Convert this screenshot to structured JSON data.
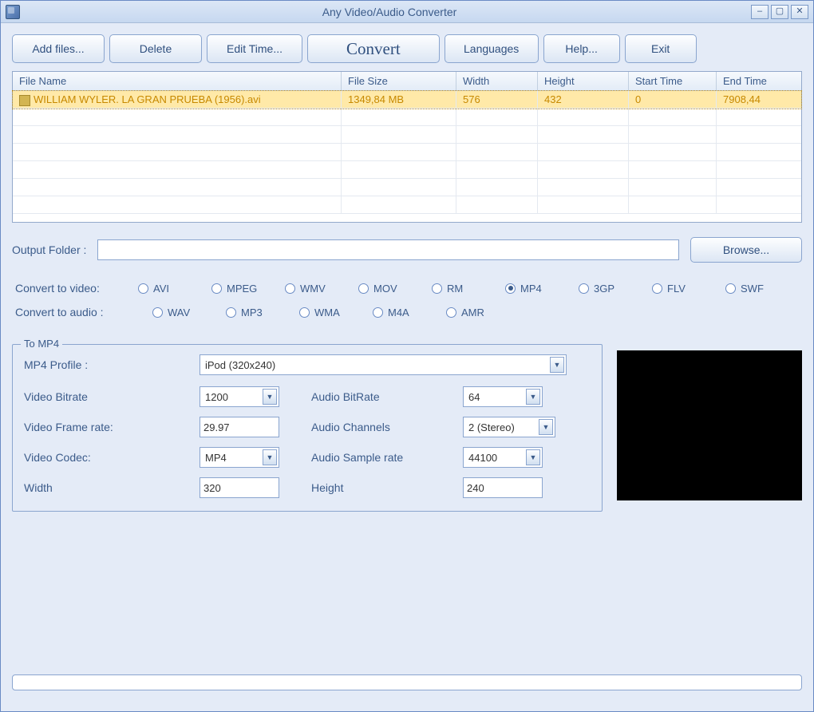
{
  "window": {
    "title": "Any Video/Audio Converter"
  },
  "toolbar": {
    "add_files": "Add files...",
    "delete": "Delete",
    "edit_time": "Edit Time...",
    "convert": "Convert",
    "languages": "Languages",
    "help": "Help...",
    "exit": "Exit"
  },
  "table": {
    "headers": {
      "file_name": "File Name",
      "file_size": "File Size",
      "width": "Width",
      "height": "Height",
      "start_time": "Start Time",
      "end_time": "End Time"
    },
    "rows": [
      {
        "file_name": "WILLIAM WYLER. LA GRAN PRUEBA (1956).avi",
        "file_size": "1349,84 MB",
        "width": "576",
        "height": "432",
        "start_time": "0",
        "end_time": "7908,44"
      }
    ]
  },
  "output": {
    "label": "Output Folder :",
    "value": "",
    "browse": "Browse..."
  },
  "video_formats": {
    "label": "Convert to video:",
    "options": [
      "AVI",
      "MPEG",
      "WMV",
      "MOV",
      "RM",
      "MP4",
      "3GP",
      "FLV",
      "SWF"
    ],
    "selected": "MP4"
  },
  "audio_formats": {
    "label": "Convert to audio :",
    "options": [
      "WAV",
      "MP3",
      "WMA",
      "M4A",
      "AMR"
    ],
    "selected": ""
  },
  "encoding": {
    "title": "To MP4",
    "profile_label": "MP4 Profile :",
    "profile_value": "iPod (320x240)",
    "video_bitrate_label": "Video Bitrate",
    "video_bitrate": "1200",
    "video_frame_rate_label": "Video Frame rate:",
    "video_frame_rate": "29.97",
    "video_codec_label": "Video Codec:",
    "video_codec": "MP4",
    "width_label": "Width",
    "width": "320",
    "audio_bitrate_label": "Audio BitRate",
    "audio_bitrate": "64",
    "audio_channels_label": "Audio Channels",
    "audio_channels": "2 (Stereo)",
    "audio_sample_rate_label": "Audio Sample rate",
    "audio_sample_rate": "44100",
    "height_label": "Height",
    "height": "240"
  }
}
